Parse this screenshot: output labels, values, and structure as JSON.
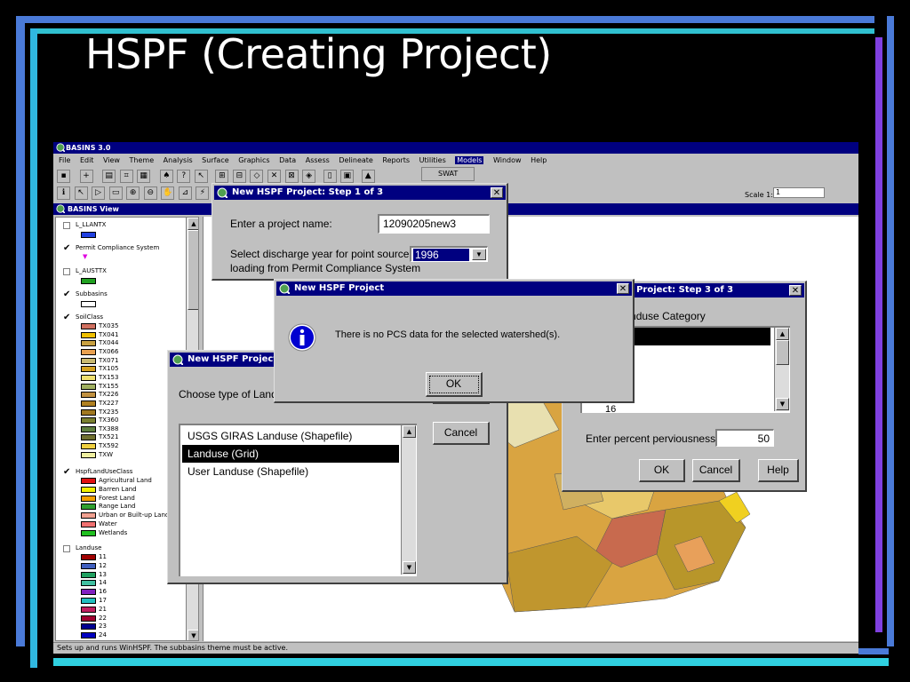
{
  "slide": {
    "title": "HSPF (Creating Project)"
  },
  "app": {
    "title": "BASINS 3.0",
    "menu": [
      "File",
      "Edit",
      "View",
      "Theme",
      "Analysis",
      "Surface",
      "Graphics",
      "Data",
      "Assess",
      "Delineate",
      "Reports",
      "Utilities",
      "Models",
      "Window",
      "Help"
    ],
    "models_dropdown_item": "SWAT",
    "scale_label": "Scale 1:",
    "scale_value": "1",
    "view_title": "BASINS View",
    "status_text": "Sets up and runs WinHSPF.  The subbasins theme must be active."
  },
  "toc": {
    "themes": [
      {
        "name": "L_LLANTX",
        "checked": false
      },
      {
        "name": "Permit Compliance System",
        "checked": true
      },
      {
        "name": "L_AUSTTX",
        "checked": false
      },
      {
        "name": "Subbasins",
        "checked": true
      },
      {
        "name": "SoilClass",
        "checked": true
      },
      {
        "name": "HspfLandUseClass",
        "checked": true
      },
      {
        "name": "Landuse",
        "checked": false
      }
    ],
    "soil_items": [
      "TX035",
      "TX041",
      "TX044",
      "TX066",
      "TX071",
      "TX105",
      "TX153",
      "TX155",
      "TX226",
      "TX227",
      "TX235",
      "TX360",
      "TX388",
      "TX521",
      "TX592",
      "TXW"
    ],
    "soil_colors": [
      "#d07060",
      "#f0c000",
      "#c8a040",
      "#e8a050",
      "#c8b870",
      "#d4a020",
      "#f0e070",
      "#a0b060",
      "#c09040",
      "#b08020",
      "#a07820",
      "#7a8030",
      "#608040",
      "#707030",
      "#f0d040",
      "#f0f0a0"
    ],
    "landuse_class_items": [
      "Agricultural Land",
      "Barren Land",
      "Forest Land",
      "Range Land",
      "Urban or Built-up Land",
      "Water",
      "Wetlands"
    ],
    "landuse_class_colors": [
      "#e01010",
      "#f0f000",
      "#f0a000",
      "#30a030",
      "#f0a090",
      "#f07070",
      "#20c020"
    ],
    "landuse_items": [
      "11",
      "12",
      "13",
      "14",
      "16",
      "17",
      "21",
      "22",
      "23",
      "24"
    ],
    "landuse_colors": [
      "#a00000",
      "#4060c0",
      "#20a060",
      "#40c0a0",
      "#8020c0",
      "#20c0c0",
      "#c02060",
      "#a00030",
      "#000090",
      "#0000c0"
    ]
  },
  "step1": {
    "title": "New HSPF Project:  Step 1 of 3",
    "project_name_label": "Enter a project name:",
    "project_name_value": "12090205new3",
    "discharge_label_line1": "Select discharge year for point source",
    "discharge_label_line2": "loading from Permit Compliance System",
    "discharge_year": "1996"
  },
  "step2": {
    "title": "New HSPF Project",
    "prompt": "Choose type of Landuse",
    "options": [
      "USGS GIRAS Landuse (Shapefile)",
      "Landuse (Grid)",
      "User Landuse (Shapefile)"
    ],
    "selected_index": 1,
    "cancel_label": "Cancel"
  },
  "step3": {
    "title": "New HSPF Project:  Step 3 of 3",
    "category_label": "Select Landuse Category",
    "list_visible_item": "16",
    "perviousness_label": "Enter percent perviousness:",
    "perviousness_value": "50",
    "ok_label": "OK",
    "cancel_label": "Cancel",
    "help_label": "Help"
  },
  "alert": {
    "title": "New HSPF Project",
    "message": "There is no PCS data for the selected watershed(s).",
    "ok_label": "OK",
    "icon": "information-icon"
  }
}
